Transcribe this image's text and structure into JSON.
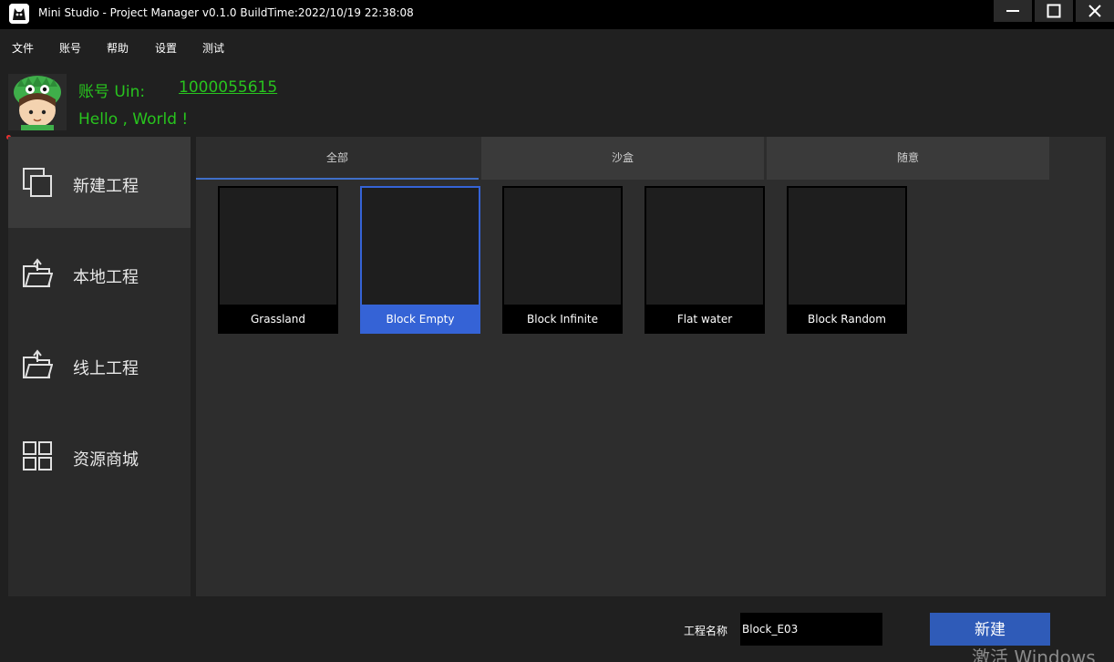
{
  "window": {
    "title": "Mini Studio - Project Manager v0.1.0 BuildTime:2022/10/19 22:38:08",
    "icons": [
      "app-logo-icon",
      "minimize-icon",
      "maximize-icon",
      "close-icon"
    ]
  },
  "menu": [
    "文件",
    "账号",
    "帮助",
    "设置",
    "测试"
  ],
  "user": {
    "account_label": "账号 Uin:",
    "uin": "1000055615",
    "greeting": "Hello , World !",
    "text_color": "#28c41e"
  },
  "sidebar": {
    "items": [
      {
        "label": "新建工程",
        "icon": "new-project-icon",
        "active": true
      },
      {
        "label": "本地工程",
        "icon": "folder-upload-icon",
        "active": false
      },
      {
        "label": "线上工程",
        "icon": "folder-upload-icon",
        "active": false
      },
      {
        "label": "资源商城",
        "icon": "grid-icon",
        "active": false
      }
    ]
  },
  "tabs": [
    {
      "label": "全部",
      "active": true
    },
    {
      "label": "沙盒",
      "active": false
    },
    {
      "label": "随意",
      "active": false
    }
  ],
  "templates": [
    {
      "label": "Grassland",
      "selected": false
    },
    {
      "label": "Block Empty",
      "selected": true
    },
    {
      "label": "Block Infinite",
      "selected": false
    },
    {
      "label": "Flat water",
      "selected": false
    },
    {
      "label": "Block Random",
      "selected": false
    }
  ],
  "footer": {
    "name_label": "工程名称",
    "name_value": "Block_E03",
    "create_button": "新建"
  },
  "watermark": "激活 Windows",
  "colors": {
    "accent": "#3563d6",
    "button": "#2f5bb8",
    "background": "#202020"
  }
}
